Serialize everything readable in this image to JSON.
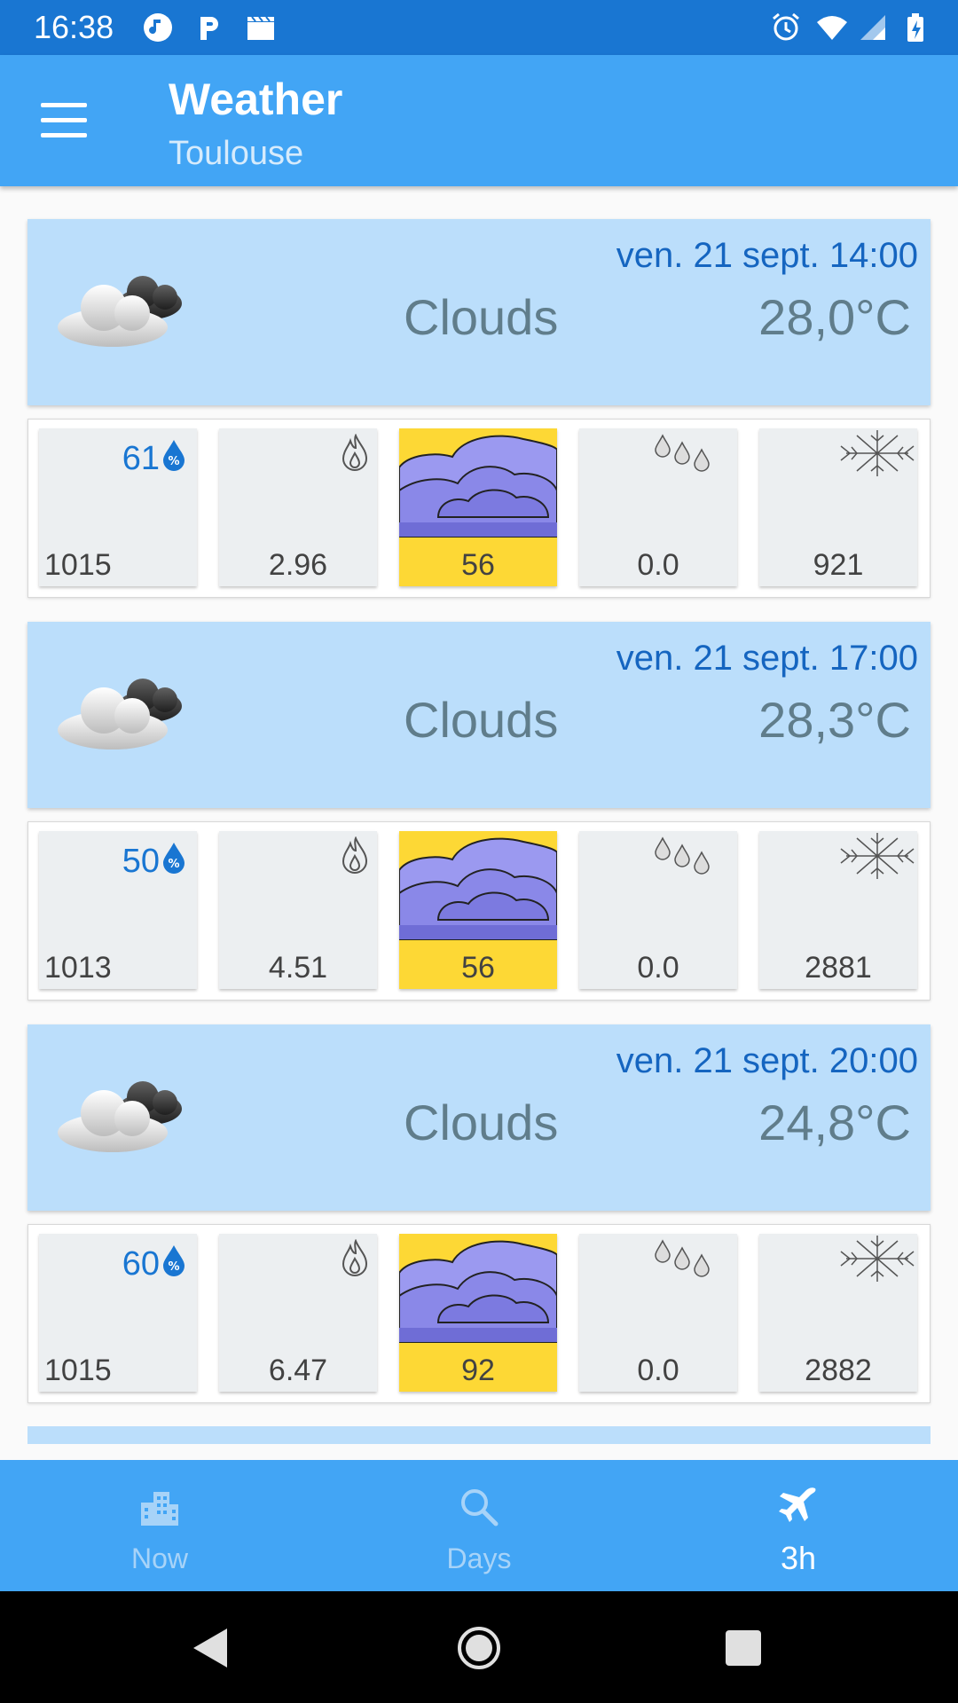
{
  "status_bar": {
    "time": "16:38",
    "left_icons": [
      "music-icon",
      "p-letter-icon",
      "clapperboard-icon"
    ],
    "right_icons": [
      "alarm-icon",
      "wifi-icon",
      "signal-icon",
      "battery-icon"
    ]
  },
  "app_bar": {
    "title": "Weather",
    "subtitle": "Toulouse",
    "menu_icon": "menu-icon"
  },
  "forecasts": [
    {
      "date": "ven. 21 sept. 14:00",
      "condition": "Clouds",
      "temperature": "28,0°C",
      "humidity": "61",
      "pressure": "1015",
      "wind": "2.96",
      "clouds": "56",
      "rain": "0.0",
      "snow": "921"
    },
    {
      "date": "ven. 21 sept. 17:00",
      "condition": "Clouds",
      "temperature": "28,3°C",
      "humidity": "50",
      "pressure": "1013",
      "wind": "4.51",
      "clouds": "56",
      "rain": "0.0",
      "snow": "2881"
    },
    {
      "date": "ven. 21 sept. 20:00",
      "condition": "Clouds",
      "temperature": "24,8°C",
      "humidity": "60",
      "pressure": "1015",
      "wind": "6.47",
      "clouds": "92",
      "rain": "0.0",
      "snow": "2882"
    }
  ],
  "bottom_nav": {
    "items": [
      {
        "label": "Now",
        "icon": "city-icon",
        "active": false
      },
      {
        "label": "Days",
        "icon": "search-icon",
        "active": false
      },
      {
        "label": "3h",
        "icon": "airplane-icon",
        "active": true
      }
    ]
  },
  "colors": {
    "status_bar": "#1976d2",
    "app_bar": "#42a5f5",
    "header_card": "#bbdefb",
    "accent_text": "#1565c0",
    "cloud_tile": "#fdd835",
    "cloud_fill": "#8a88e8"
  }
}
